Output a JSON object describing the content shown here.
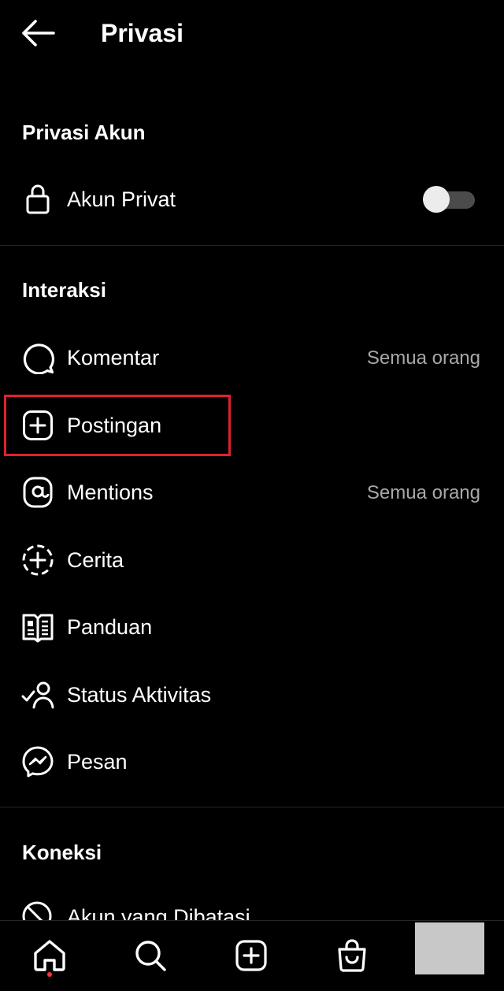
{
  "header": {
    "title": "Privasi",
    "back_icon": "arrow-left-icon"
  },
  "account_privacy": {
    "section_title": "Privasi Akun",
    "private_account": {
      "label": "Akun Privat",
      "icon": "lock-icon",
      "toggle_on": false
    }
  },
  "interactions": {
    "section_title": "Interaksi",
    "items": [
      {
        "label": "Komentar",
        "value": "Semua orang",
        "icon": "comment-icon"
      },
      {
        "label": "Postingan",
        "value": "",
        "icon": "plus-square-icon"
      },
      {
        "label": "Mentions",
        "value": "Semua orang",
        "icon": "at-icon"
      },
      {
        "label": "Cerita",
        "value": "",
        "icon": "story-add-icon"
      },
      {
        "label": "Panduan",
        "value": "",
        "icon": "guide-book-icon"
      },
      {
        "label": "Status Aktivitas",
        "value": "",
        "icon": "activity-status-icon"
      },
      {
        "label": "Pesan",
        "value": "",
        "icon": "messenger-icon"
      }
    ]
  },
  "connections": {
    "section_title": "Koneksi",
    "items": [
      {
        "label": "Akun yang Dibatasi",
        "icon": "restricted-icon"
      }
    ]
  },
  "bottom_nav": {
    "items": [
      "home-icon",
      "search-icon",
      "create-icon",
      "shop-icon",
      "profile-avatar"
    ],
    "active": "home-icon",
    "notification_dot_color": "#ff3040"
  },
  "colors": {
    "background": "#000000",
    "text": "#ffffff",
    "secondary_text": "#a8a8a8",
    "highlight_border": "#e0202e"
  }
}
